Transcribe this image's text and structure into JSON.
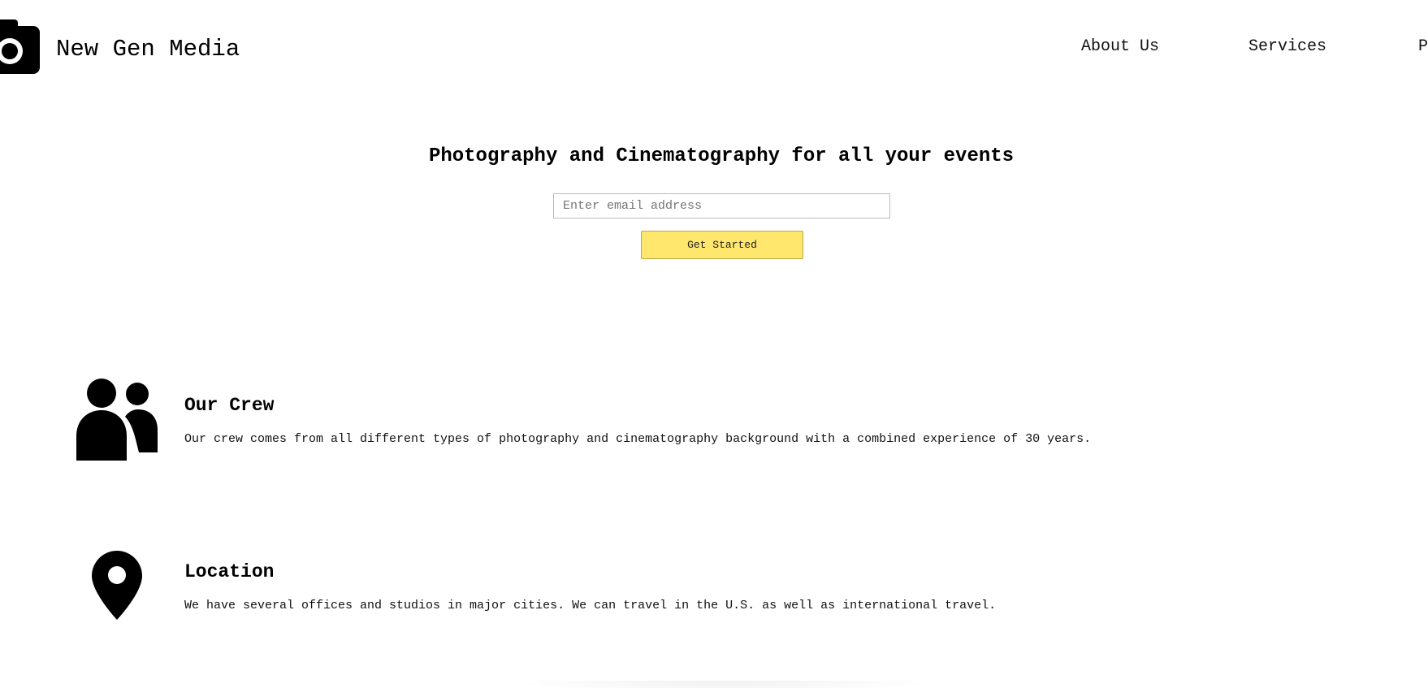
{
  "header": {
    "brand": "New Gen Media",
    "logo_icon": "camera-icon",
    "nav": {
      "about": "About Us",
      "services": "Services",
      "partial": "P"
    }
  },
  "hero": {
    "title": "Photography and Cinematography for all your events",
    "email_placeholder": "Enter email address",
    "button_label": "Get Started",
    "button_color": "#ffe66d"
  },
  "features": {
    "crew": {
      "icon": "users-icon",
      "title": "Our Crew",
      "text": "Our crew comes from all different types of photography and cinematography background with a combined experience of 30 years."
    },
    "location": {
      "icon": "map-pin-icon",
      "title": "Location",
      "text": "We have several offices and studios in major cities. We can travel in the U.S. as well as international travel."
    }
  }
}
